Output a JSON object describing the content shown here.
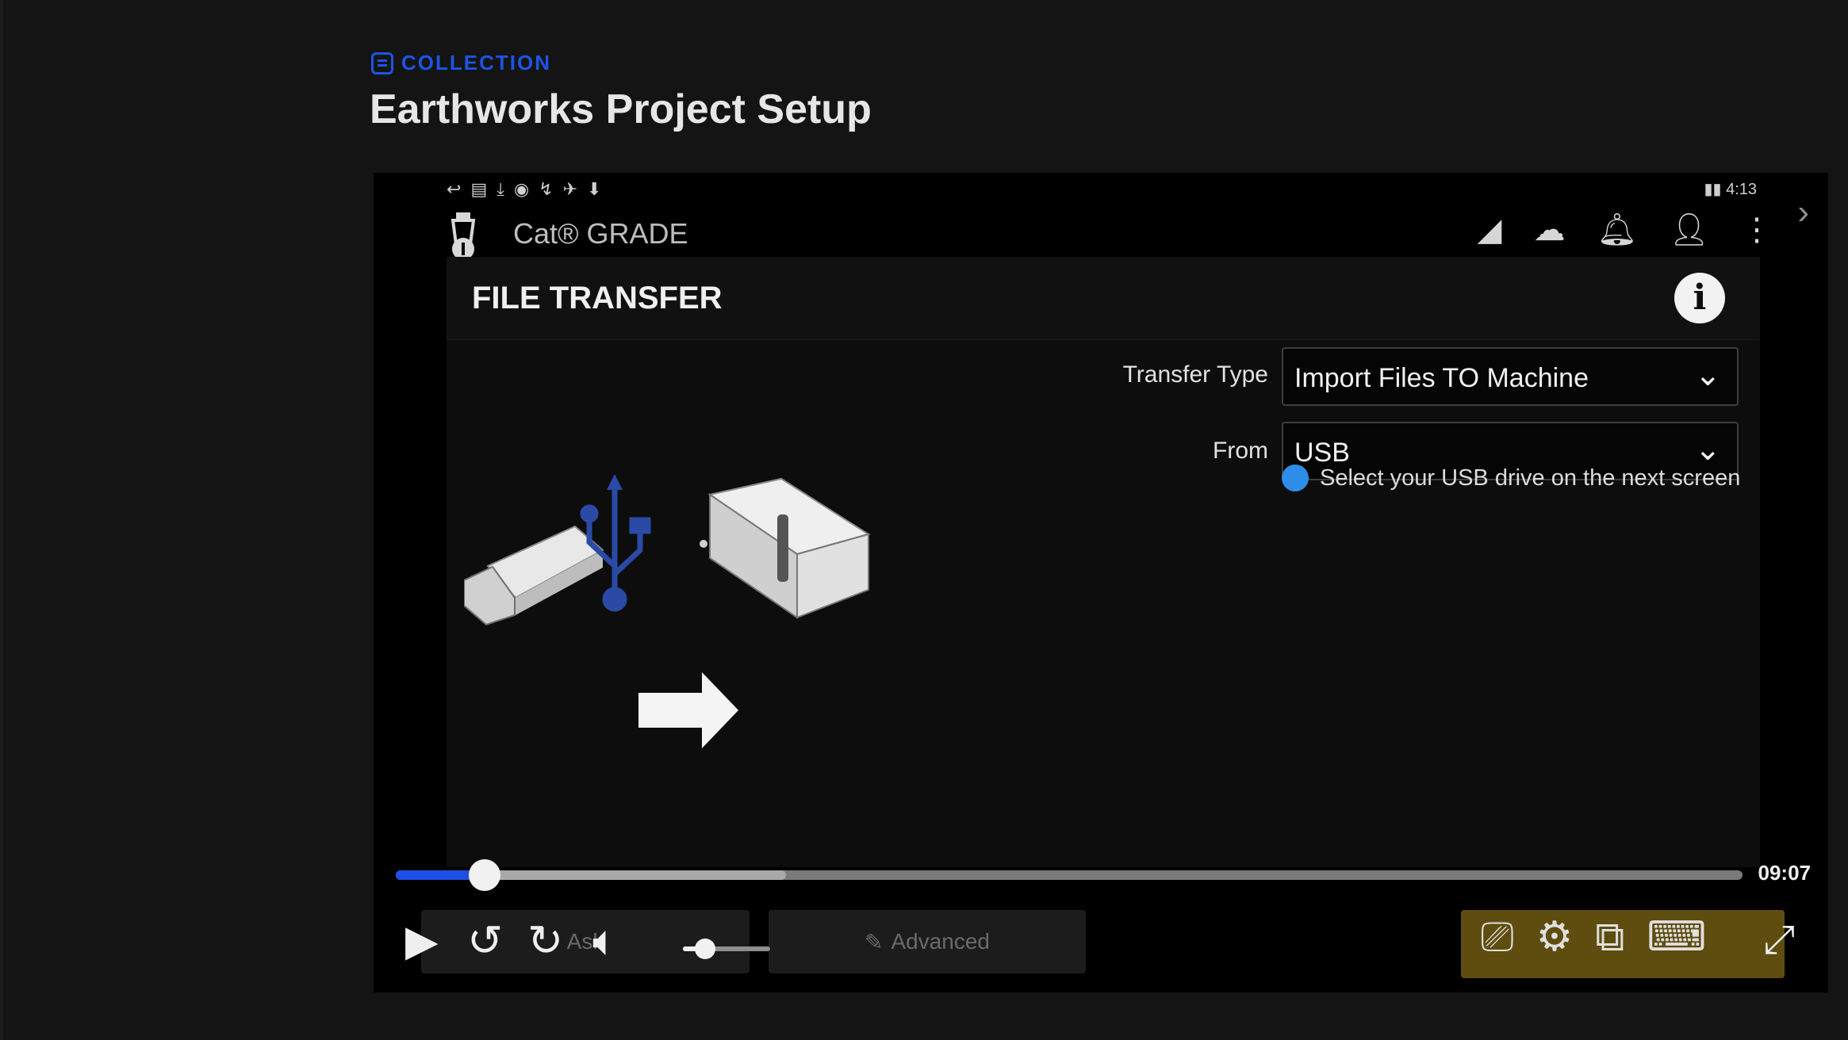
{
  "header": {
    "collection_label": "COLLECTION",
    "title": "Earthworks Project Setup"
  },
  "video": {
    "status_bar": {
      "left_icons": [
        "↩",
        "▤",
        "⤓",
        "◉",
        "↯",
        "✈",
        "⬇"
      ],
      "right_text": "▮▮ 4:13"
    },
    "app": {
      "name": "Cat® GRADE",
      "icons": [
        "signal-icon",
        "cloud-icon",
        "bell-icon",
        "user-icon",
        "more-vertical-icon"
      ]
    },
    "screen": {
      "title": "FILE TRANSFER",
      "info_icon": "i",
      "transfer_type_label": "Transfer Type",
      "transfer_type_value": "Import Files TO Machine",
      "from_label": "From",
      "from_value": "USB",
      "hint": "Select your USB drive on the next screen"
    },
    "player": {
      "progress_fraction": 0.066,
      "buffered_fraction": 0.29,
      "volume_fraction": 0.25,
      "time_remaining": "09:07",
      "ghost_left_label": "Ask",
      "ghost_right_label": "Advanced",
      "colors": {
        "progress": "#1f4fe6",
        "highlight": "#5f4d0f"
      }
    }
  }
}
